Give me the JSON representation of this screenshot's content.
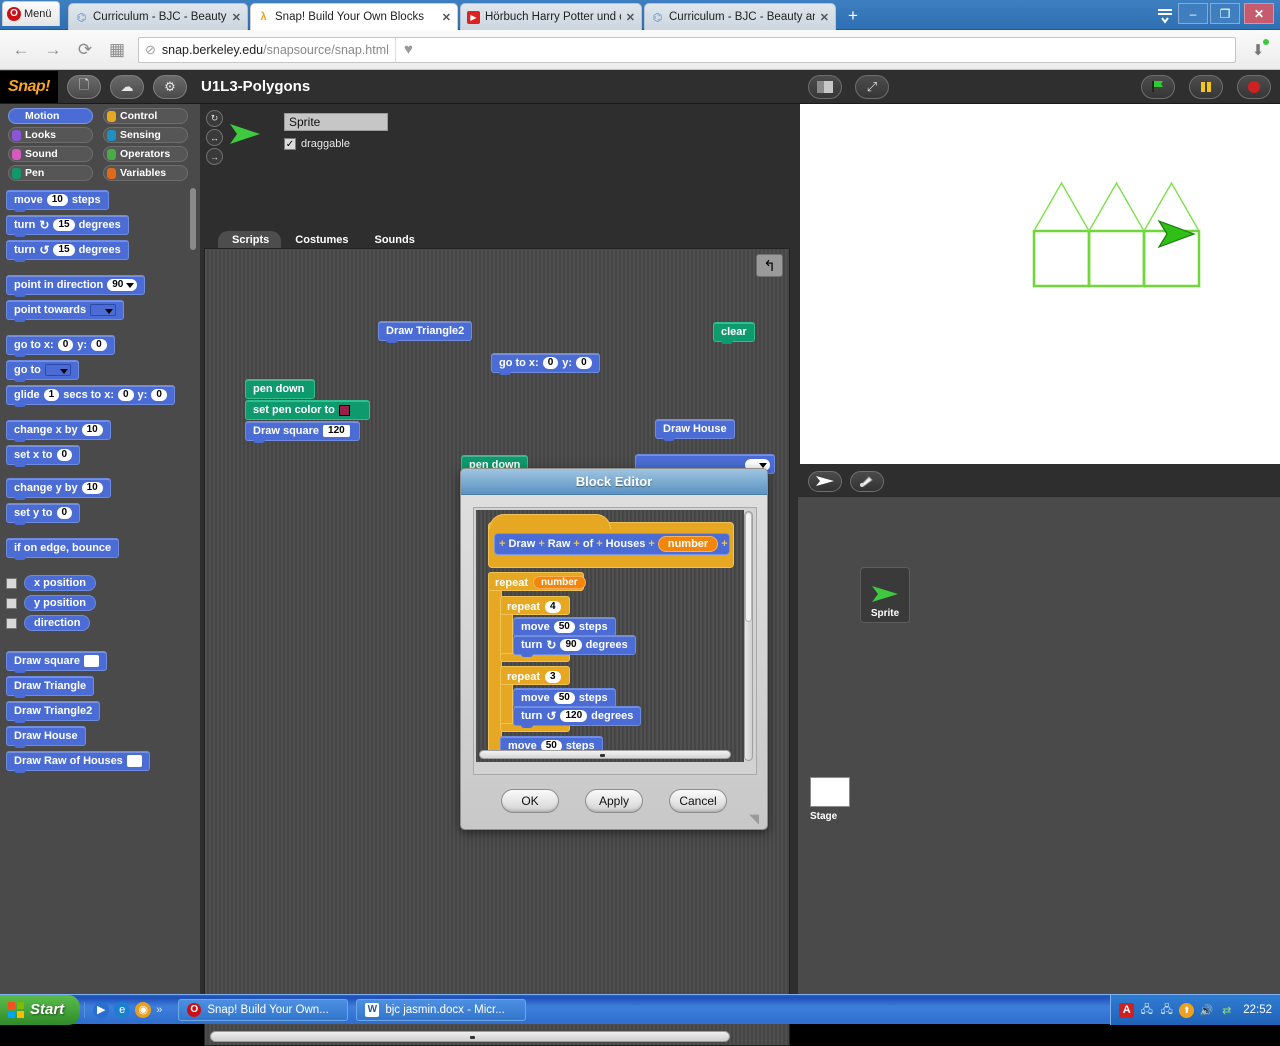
{
  "browser": {
    "menu_label": "Menü",
    "tabs": [
      {
        "label": "Curriculum - BJC - Beauty and",
        "icon": "page-icon",
        "active": false
      },
      {
        "label": "Snap! Build Your Own Blocks",
        "icon": "snap-icon",
        "active": true
      },
      {
        "label": "Hörbuch Harry Potter und de",
        "icon": "youtube-icon",
        "active": false
      },
      {
        "label": "Curriculum - BJC - Beauty an",
        "icon": "page-icon",
        "active": false
      }
    ],
    "new_tab_label": "+",
    "window_buttons": {
      "minimize": "–",
      "maximize": "❐",
      "close": "✕"
    },
    "nav": {
      "back": "←",
      "forward": "→",
      "reload": "⟳",
      "apps": "▦"
    },
    "url_prefix": "snap.berkeley.edu",
    "url_suffix": "/snapsource/snap.html"
  },
  "snap": {
    "logo": "Snap!",
    "project_name": "U1L3-Polygons",
    "toolbar_buttons": [
      "file-icon",
      "cloud-icon",
      "settings-icon"
    ],
    "right_buttons": [
      "stage-size-icon",
      "fullscreen-icon"
    ],
    "control_buttons": [
      "green-flag-icon",
      "pause-icon",
      "stop-icon"
    ],
    "categories": [
      {
        "label": "Motion",
        "color": "#4a6cd4",
        "selected": true
      },
      {
        "label": "Control",
        "color": "#e6a822",
        "selected": false
      },
      {
        "label": "Looks",
        "color": "#8a55d6",
        "selected": false
      },
      {
        "label": "Sensing",
        "color": "#2090c0",
        "selected": false
      },
      {
        "label": "Sound",
        "color": "#d45ac0",
        "selected": false
      },
      {
        "label": "Operators",
        "color": "#4aab4a",
        "selected": false
      },
      {
        "label": "Pen",
        "color": "#0e9a6c",
        "selected": false
      },
      {
        "label": "Variables",
        "color": "#e06a1b",
        "selected": false
      }
    ],
    "palette": {
      "move_steps": {
        "pre": "move",
        "value": "10",
        "post": "steps"
      },
      "turn_cw": {
        "pre": "turn",
        "arrow": "↻",
        "value": "15",
        "post": "degrees"
      },
      "turn_ccw": {
        "pre": "turn",
        "arrow": "↺",
        "value": "15",
        "post": "degrees"
      },
      "point_in_direction": {
        "pre": "point in direction",
        "value": "90"
      },
      "point_towards": {
        "pre": "point towards"
      },
      "go_to_xy": {
        "pre": "go to x:",
        "x": "0",
        "mid": "y:",
        "y": "0"
      },
      "go_to": {
        "pre": "go to"
      },
      "glide": {
        "pre": "glide",
        "secs": "1",
        "mid1": "secs to x:",
        "x": "0",
        "mid2": "y:",
        "y": "0"
      },
      "change_x": {
        "pre": "change x by",
        "value": "10"
      },
      "set_x": {
        "pre": "set x to",
        "value": "0"
      },
      "change_y": {
        "pre": "change y by",
        "value": "10"
      },
      "set_y": {
        "pre": "set y to",
        "value": "0"
      },
      "if_on_edge": {
        "pre": "if on edge, bounce"
      },
      "x_position": "x position",
      "y_position": "y position",
      "direction": "direction",
      "custom": [
        {
          "label": "Draw square",
          "has_slot": true
        },
        {
          "label": "Draw Triangle",
          "has_slot": false
        },
        {
          "label": "Draw Triangle2",
          "has_slot": false
        },
        {
          "label": "Draw House",
          "has_slot": false
        },
        {
          "label": "Draw Raw of Houses",
          "has_slot": true
        }
      ]
    },
    "sprite_header": {
      "name_value": "Sprite",
      "draggable_label": "draggable",
      "draggable_checked": "✓",
      "rotation_buttons": [
        "rotate-free-icon",
        "rotate-leftright-icon",
        "rotate-none-icon"
      ]
    },
    "tabs": [
      {
        "label": "Scripts",
        "active": true
      },
      {
        "label": "Costumes",
        "active": false
      },
      {
        "label": "Sounds",
        "active": false
      }
    ],
    "scripts": {
      "draw_triangle2": "Draw Triangle2",
      "clear": "clear",
      "goto_pre": "go to x:",
      "goto_x": "0",
      "goto_mid": "y:",
      "goto_y": "0",
      "pen_down": "pen down",
      "set_pen_color": "set pen color to",
      "pen_color_hex": "#9c1f4b",
      "draw_square_label": "Draw square",
      "draw_square_value": "120",
      "draw_house": "Draw House",
      "pen_down2": "pen down",
      "undo_icon": "undo-arrow-icon"
    },
    "corral": {
      "buttons": [
        "new-turtle-icon",
        "paint-new-icon"
      ],
      "sprite_label": "Sprite",
      "stage_label": "Stage"
    }
  },
  "block_editor": {
    "title": "Block Editor",
    "prototype": {
      "plus": "+",
      "words": [
        "Draw",
        "Raw",
        "of",
        "Houses"
      ],
      "param": "number"
    },
    "body": {
      "repeat_outer": {
        "label": "repeat",
        "value": "number",
        "is_param": true
      },
      "repeat_4": {
        "label": "repeat",
        "value": "4"
      },
      "move_50_a": {
        "pre": "move",
        "value": "50",
        "post": "steps"
      },
      "turn_90": {
        "pre": "turn",
        "arrow": "↻",
        "value": "90",
        "post": "degrees"
      },
      "repeat_3": {
        "label": "repeat",
        "value": "3"
      },
      "move_50_b": {
        "pre": "move",
        "value": "50",
        "post": "steps"
      },
      "turn_120": {
        "pre": "turn",
        "arrow": "↺",
        "value": "120",
        "post": "degrees"
      },
      "move_50_c": {
        "pre": "move",
        "value": "50",
        "post": "steps"
      }
    },
    "buttons": [
      {
        "label": "OK"
      },
      {
        "label": "Apply"
      },
      {
        "label": "Cancel"
      }
    ]
  },
  "stage_drawing": {
    "description": "three green houses drawn with pen, sprite arrow at right",
    "pen_color": "#6ed839",
    "house_count": 3
  },
  "taskbar": {
    "start_label": "Start",
    "quicklaunch": [
      "media-player-icon",
      "internet-explorer-icon",
      "chrome-icon",
      "more-icon"
    ],
    "windows": [
      {
        "label": "Snap! Build Your Own...",
        "icon": "opera-icon"
      },
      {
        "label": "bjc jasmin.docx - Micr...",
        "icon": "word-icon"
      }
    ],
    "tray_icons": [
      "antivirus-icon",
      "network-icon",
      "network-error-icon",
      "update-icon",
      "volume-icon",
      "sync-icon"
    ],
    "clock": "22:52"
  }
}
